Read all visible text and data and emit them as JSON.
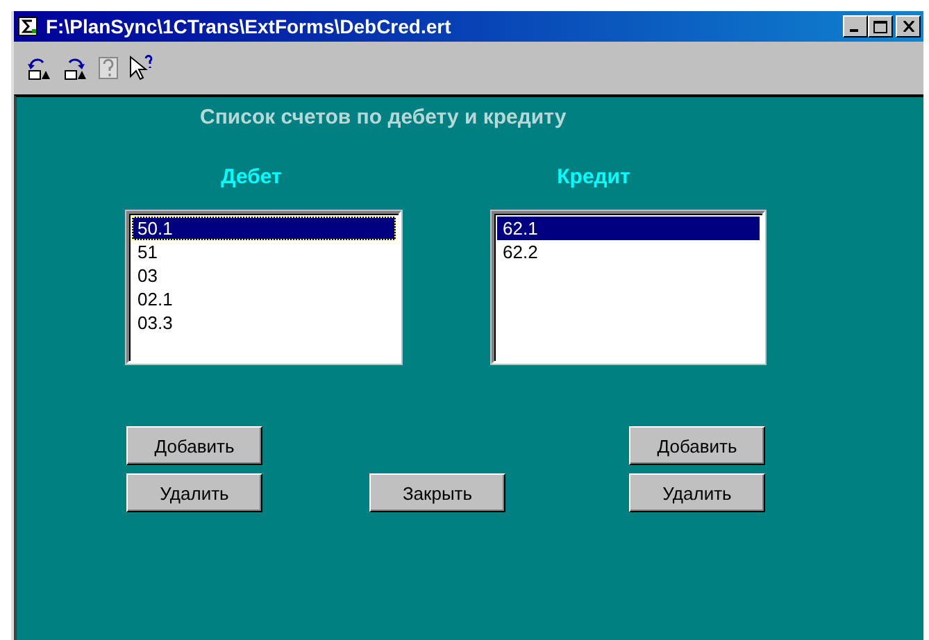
{
  "window": {
    "title": "F:\\PlanSync\\1CTrans\\ExtForms\\DebCred.ert"
  },
  "form": {
    "heading": "Список счетов по дебету и кредиту",
    "debit": {
      "label": "Дебет",
      "items": [
        {
          "text": "50.1",
          "selected": true
        },
        {
          "text": "51",
          "selected": false
        },
        {
          "text": "03",
          "selected": false
        },
        {
          "text": "02.1",
          "selected": false
        },
        {
          "text": "03.3",
          "selected": false
        }
      ],
      "buttons": [
        "Добавить",
        "Удалить"
      ]
    },
    "credit": {
      "label": "Кредит",
      "items": [
        {
          "text": "62.1",
          "selected": true
        },
        {
          "text": "62.2",
          "selected": false
        }
      ],
      "buttons": [
        "Добавить",
        "Удалить"
      ]
    },
    "close_button": "Закрыть"
  }
}
